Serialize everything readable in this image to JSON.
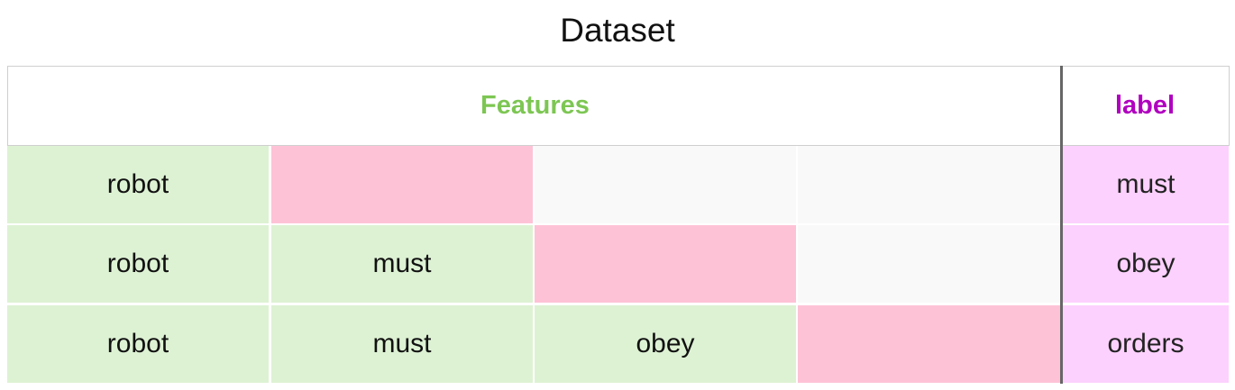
{
  "title": "Dataset",
  "header": {
    "features": "Features",
    "label": "label"
  },
  "colors": {
    "features_text": "#7dc653",
    "label_text": "#b100c0",
    "word_cell": "#ddf2d3",
    "target_cell": "#fec2d6",
    "empty_cell": "#f9f9f9",
    "label_cell": "#fcd1fd"
  },
  "rows": [
    {
      "cells": [
        {
          "text": "robot",
          "kind": "word"
        },
        {
          "text": "",
          "kind": "target"
        },
        {
          "text": "",
          "kind": "empty"
        },
        {
          "text": "",
          "kind": "empty"
        }
      ],
      "label": "must"
    },
    {
      "cells": [
        {
          "text": "robot",
          "kind": "word"
        },
        {
          "text": "must",
          "kind": "word"
        },
        {
          "text": "",
          "kind": "target"
        },
        {
          "text": "",
          "kind": "empty"
        }
      ],
      "label": "obey"
    },
    {
      "cells": [
        {
          "text": "robot",
          "kind": "word"
        },
        {
          "text": "must",
          "kind": "word"
        },
        {
          "text": "obey",
          "kind": "word"
        },
        {
          "text": "",
          "kind": "target"
        }
      ],
      "label": "orders"
    }
  ]
}
